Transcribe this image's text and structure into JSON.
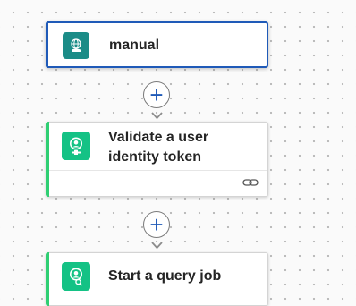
{
  "colors": {
    "trigger_border": "#1f5ab8",
    "trigger_icon_bg": "#1b8c87",
    "action_accent": "#2fcf73",
    "action_icon_bg": "#14c285",
    "connector": "#8d8d8d",
    "plus": "#1f5ab8"
  },
  "steps": [
    {
      "title": "manual",
      "icon": "globe-hand-icon",
      "selected": true
    },
    {
      "title": "Validate a user identity token",
      "icon": "user-badge-icon",
      "footer_icon": "link-icon"
    },
    {
      "title": "Start a query job",
      "icon": "user-search-icon"
    }
  ],
  "add_step": {
    "symbol": "+"
  }
}
